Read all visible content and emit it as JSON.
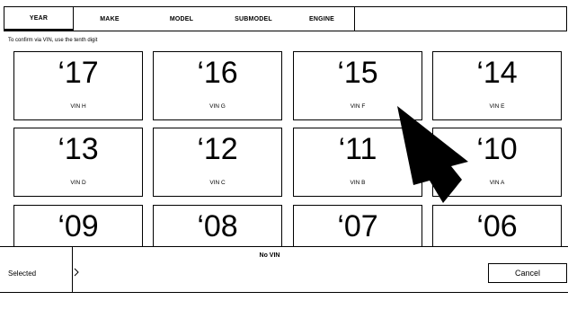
{
  "tabs": [
    {
      "label": "YEAR",
      "active": true
    },
    {
      "label": "MAKE",
      "active": false
    },
    {
      "label": "MODEL",
      "active": false
    },
    {
      "label": "SUBMODEL",
      "active": false
    },
    {
      "label": "ENGINE",
      "active": false
    }
  ],
  "hint": "To confirm via VIN, use the tenth digit",
  "years": [
    {
      "year": "‘17",
      "vin": "VIN H"
    },
    {
      "year": "‘16",
      "vin": "VIN G"
    },
    {
      "year": "‘15",
      "vin": "VIN F"
    },
    {
      "year": "‘14",
      "vin": "VIN E"
    },
    {
      "year": "‘13",
      "vin": "VIN D"
    },
    {
      "year": "‘12",
      "vin": "VIN C"
    },
    {
      "year": "‘11",
      "vin": "VIN B"
    },
    {
      "year": "‘10",
      "vin": "VIN A"
    },
    {
      "year": "‘09",
      "vin": ""
    },
    {
      "year": "‘08",
      "vin": ""
    },
    {
      "year": "‘07",
      "vin": ""
    },
    {
      "year": "‘06",
      "vin": ""
    }
  ],
  "bottom": {
    "selected_label": "Selected",
    "selected_value": "No VIN",
    "cancel_label": "Cancel"
  },
  "icons": {
    "arrow": "arrow-pointer-icon",
    "chevron": "chevron-right-icon"
  }
}
